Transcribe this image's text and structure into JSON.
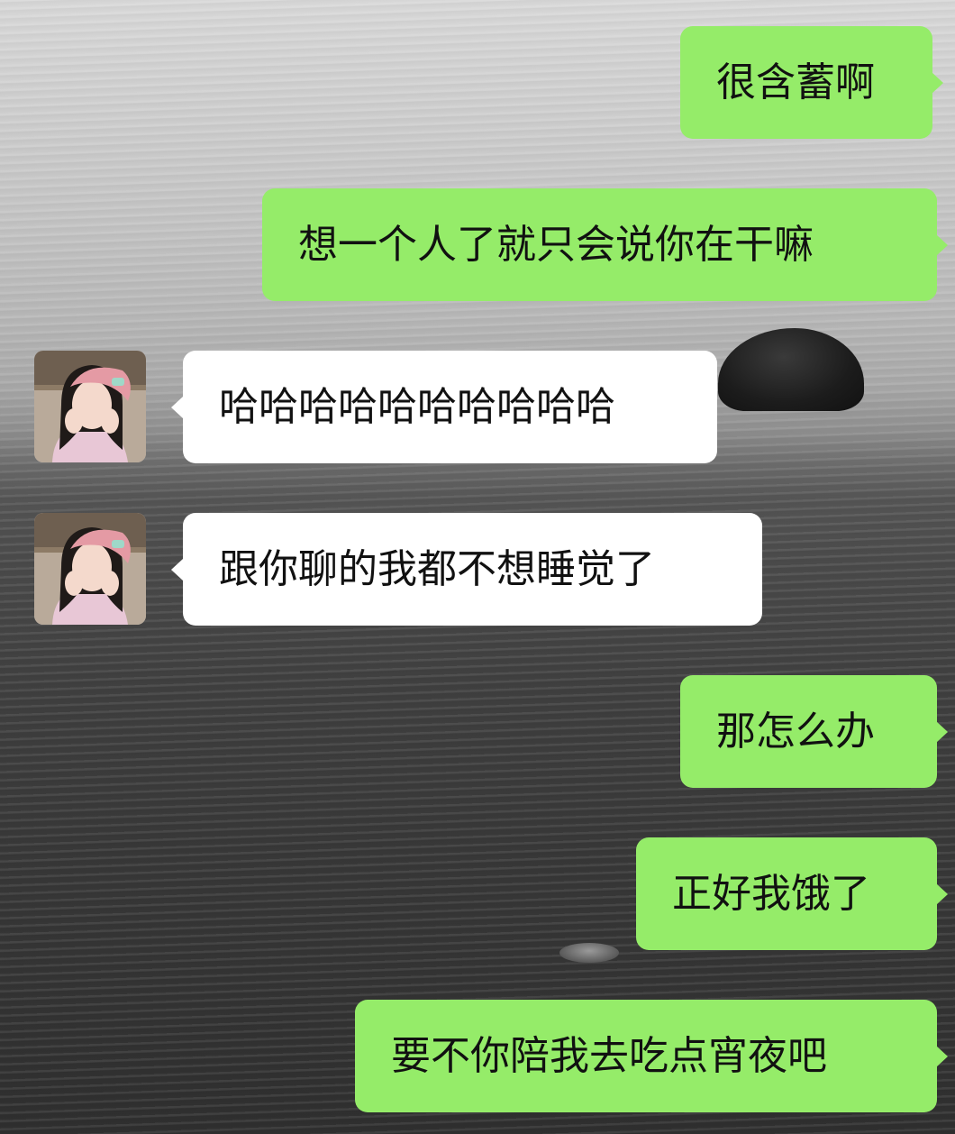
{
  "messages": [
    {
      "side": "sent",
      "text": "很含蓄啊"
    },
    {
      "side": "sent",
      "text": "想一个人了就只会说你在干嘛"
    },
    {
      "side": "received",
      "text": "哈哈哈哈哈哈哈哈哈哈"
    },
    {
      "side": "received",
      "text": "跟你聊的我都不想睡觉了"
    },
    {
      "side": "sent",
      "text": "那怎么办"
    },
    {
      "side": "sent",
      "text": "正好我饿了"
    },
    {
      "side": "sent",
      "text": "要不你陪我去吃点宵夜吧"
    }
  ],
  "avatar": {
    "icon": "avatar-girl-pink-beret",
    "beret_color": "#e49aa4"
  },
  "colors": {
    "sent_bubble": "#95ec69",
    "received_bubble": "#ffffff"
  }
}
